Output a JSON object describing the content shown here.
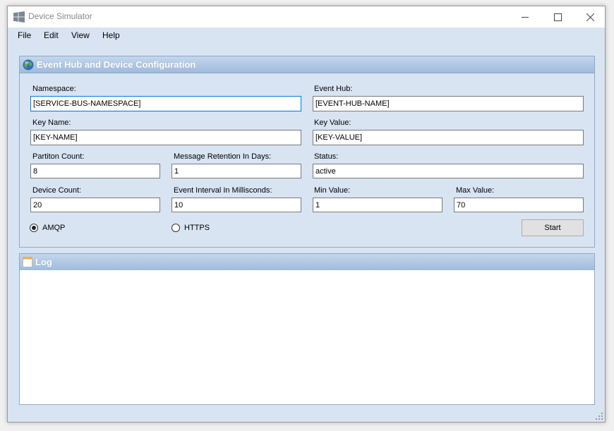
{
  "window": {
    "title": "Device Simulator"
  },
  "menu": [
    {
      "label": "File"
    },
    {
      "label": "Edit"
    },
    {
      "label": "View"
    },
    {
      "label": "Help"
    }
  ],
  "config_panel": {
    "title": "Event Hub and Device Configuration",
    "namespace": {
      "label": "Namespace:",
      "value": "[SERVICE-BUS-NAMESPACE]"
    },
    "event_hub": {
      "label": "Event Hub:",
      "value": "[EVENT-HUB-NAME]"
    },
    "key_name": {
      "label": "Key Name:",
      "value": "[KEY-NAME]"
    },
    "key_value": {
      "label": "Key Value:",
      "value": "[KEY-VALUE]"
    },
    "partition_count": {
      "label": "Partiton Count:",
      "value": "8"
    },
    "message_retention": {
      "label": "Message Retention In Days:",
      "value": "1"
    },
    "status": {
      "label": "Status:",
      "value": "active"
    },
    "device_count": {
      "label": "Device Count:",
      "value": "20"
    },
    "event_interval": {
      "label": "Event Interval In Millisconds:",
      "value": "10"
    },
    "min_value": {
      "label": "Min Value:",
      "value": "1"
    },
    "max_value": {
      "label": "Max Value:",
      "value": "70"
    },
    "protocols": [
      {
        "label": "AMQP",
        "selected": true
      },
      {
        "label": "HTTPS",
        "selected": false
      }
    ],
    "start_label": "Start"
  },
  "log_panel": {
    "title": "Log"
  }
}
